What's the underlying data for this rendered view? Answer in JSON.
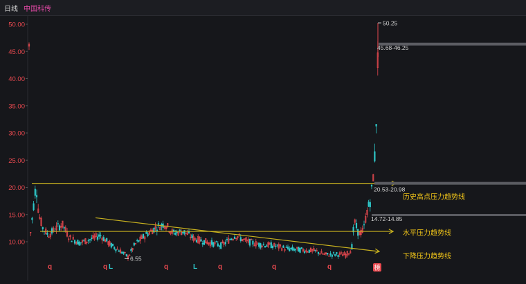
{
  "header": {
    "period": "日线",
    "stock_name": "中国科传"
  },
  "colors": {
    "background": "#16171b",
    "axis_text": "#e8494f",
    "up": "#e8494f",
    "down": "#2ec7c9",
    "trendline": "#c9b21f",
    "annotation_text": "#f0c419",
    "price_label": "#cfcfcf",
    "marker_q": "#e8494f",
    "marker_l": "#2ec7c9",
    "badge_bg": "#e8494f"
  },
  "chart_data": {
    "type": "candlestick",
    "y_ticks": [
      "50.00",
      "45.00",
      "40.00",
      "35.00",
      "30.00",
      "25.00",
      "20.00",
      "15.00",
      "10.00"
    ],
    "ylim": [
      5.5,
      52
    ],
    "price_labels": {
      "top_high": "50.25",
      "recent_range": "45.68-46.25",
      "resistance1": "20.53-20.98",
      "resistance2": "14.72-14.85",
      "low": "6.55"
    },
    "annotations": {
      "historic_high_line": "历史高点压力趋势线",
      "horizontal_line": "水平压力趋势线",
      "descending_line": "下降压力趋势线"
    },
    "markers": [
      "q",
      "q",
      "L",
      "q",
      "L",
      "q",
      "q",
      "q"
    ],
    "badge": "榜"
  }
}
